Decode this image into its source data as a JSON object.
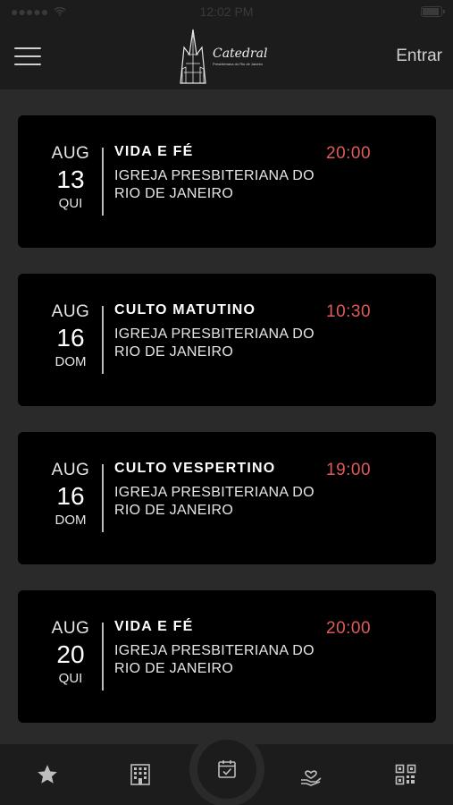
{
  "status": {
    "time": "12:02 PM"
  },
  "header": {
    "logo_name": "Catedral",
    "logo_sub": "Presbiteriana do Rio de Janeiro",
    "login_label": "Entrar"
  },
  "events": [
    {
      "month": "AUG",
      "day": "13",
      "weekday": "QUI",
      "title": "VIDA E FÉ",
      "location": "IGREJA PRESBITERIANA DO RIO DE JANEIRO",
      "time": "20:00"
    },
    {
      "month": "AUG",
      "day": "16",
      "weekday": "DOM",
      "title": "CULTO MATUTINO",
      "location": "IGREJA PRESBITERIANA DO RIO DE JANEIRO",
      "time": "10:30"
    },
    {
      "month": "AUG",
      "day": "16",
      "weekday": "DOM",
      "title": "CULTO VESPERTINO",
      "location": "IGREJA PRESBITERIANA DO RIO DE JANEIRO",
      "time": "19:00"
    },
    {
      "month": "AUG",
      "day": "20",
      "weekday": "QUI",
      "title": "VIDA E FÉ",
      "location": "IGREJA PRESBITERIANA DO RIO DE JANEIRO",
      "time": "20:00"
    }
  ],
  "tabs": [
    {
      "icon": "star-icon"
    },
    {
      "icon": "building-icon"
    },
    {
      "icon": "calendar-check-icon"
    },
    {
      "icon": "hand-heart-icon"
    },
    {
      "icon": "qr-code-icon"
    }
  ],
  "colors": {
    "accent_time": "#e05a5a",
    "card_bg": "#000000",
    "page_bg": "#2a2a2a",
    "bar_bg": "#1c1c1c"
  }
}
